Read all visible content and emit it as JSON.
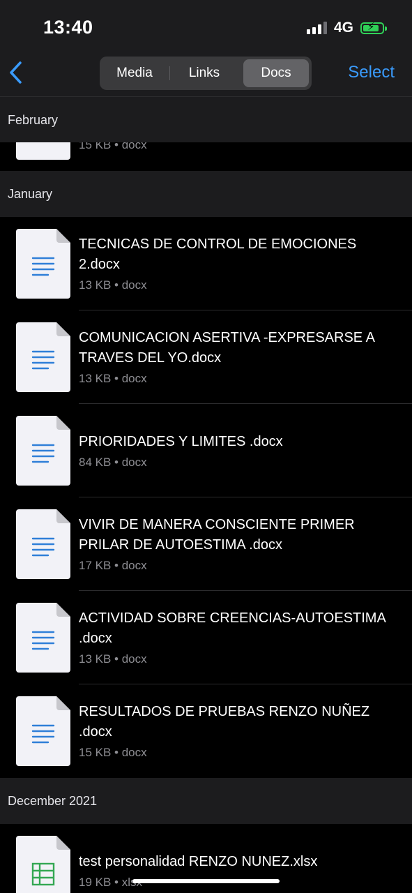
{
  "status": {
    "time": "13:40",
    "network": "4G"
  },
  "tabs": [
    {
      "label": "Media",
      "selected": false
    },
    {
      "label": "Links",
      "selected": false
    },
    {
      "label": "Docs",
      "selected": true
    }
  ],
  "nav": {
    "select_label": "Select"
  },
  "sections": {
    "february": "February",
    "january": "January",
    "december": "December 2021"
  },
  "february_items": [
    {
      "meta": "15 KB • docx"
    }
  ],
  "january_items": [
    {
      "title": "TECNICAS DE CONTROL DE EMOCIONES 2.docx",
      "meta": "13 KB • docx"
    },
    {
      "title": "COMUNICACION ASERTIVA  -EXPRESARSE A TRAVES DEL YO.docx",
      "meta": "13 KB • docx"
    },
    {
      "title": "PRIORIDADES Y LIMITES .docx",
      "meta": "84 KB • docx"
    },
    {
      "title": "VIVIR DE MANERA CONSCIENTE PRIMER PRILAR DE AUTOESTIMA .docx",
      "meta": "17 KB • docx"
    },
    {
      "title": "ACTIVIDAD SOBRE CREENCIAS-AUTOESTIMA  .docx",
      "meta": "13 KB • docx"
    },
    {
      "title": "RESULTADOS DE PRUEBAS  RENZO NUÑEZ   .docx",
      "meta": "15 KB • docx"
    }
  ],
  "december_items": [
    {
      "title": "test personalidad RENZO NUNEZ.xlsx",
      "meta": "19 KB • xlsx"
    }
  ],
  "colors": {
    "accent": "#3a9bfc",
    "doc_lines": "#2f7fd8",
    "sheet": "#34a853",
    "battery": "#30d158"
  }
}
